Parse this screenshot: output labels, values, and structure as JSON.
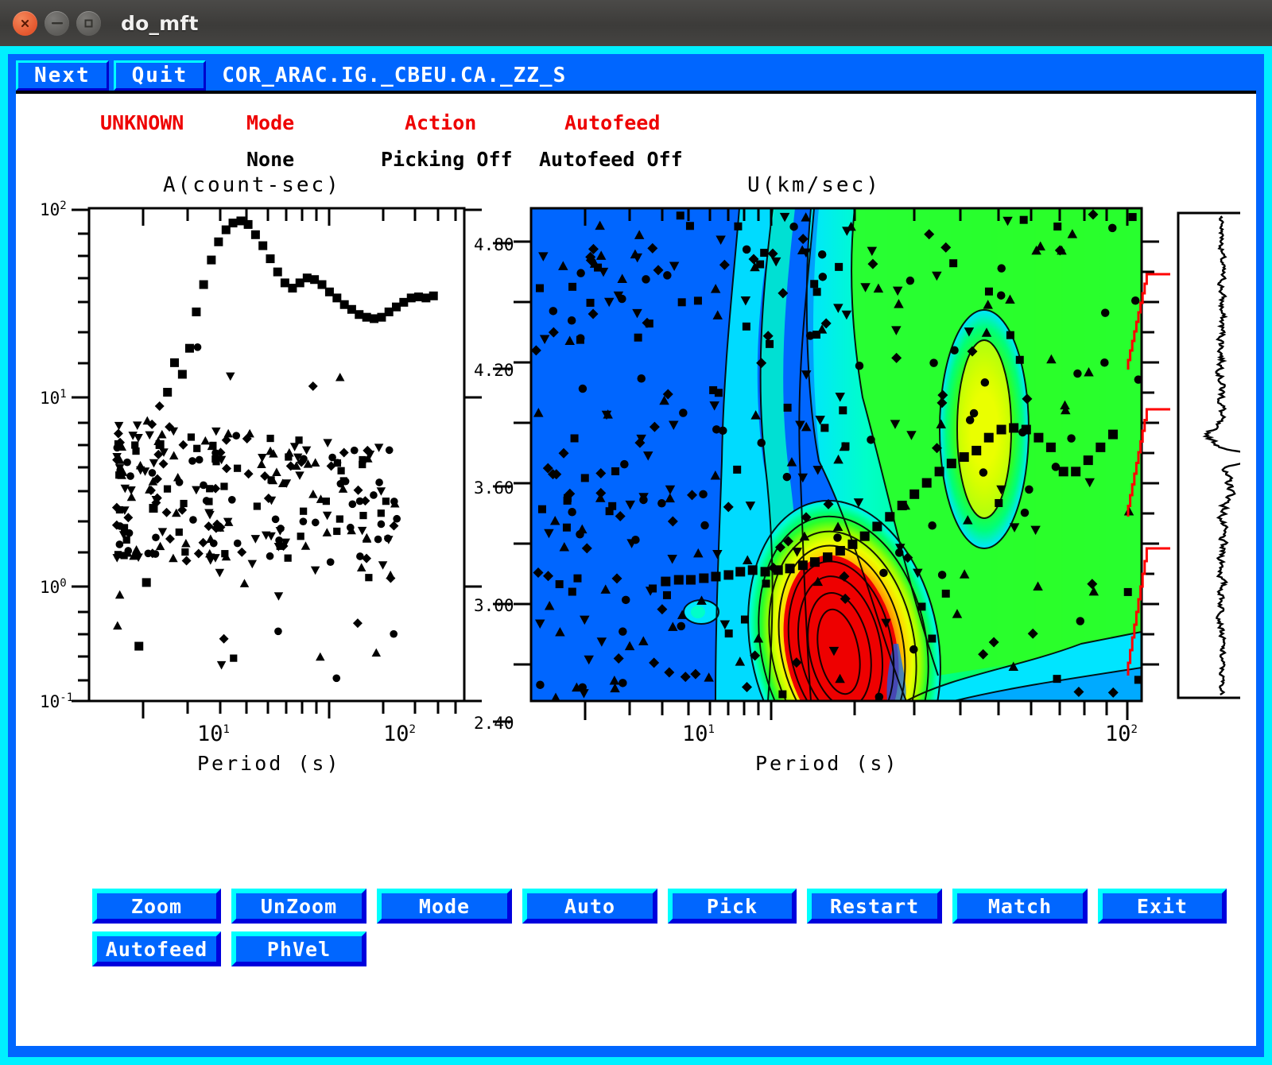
{
  "window": {
    "title": "do_mft",
    "buttons": {
      "close": "close-icon",
      "minimize": "minimize-icon",
      "maximize": "maximize-icon"
    },
    "frame_outer_color": "#00f0ff",
    "frame_inner_color": "#0066ff"
  },
  "menubar": {
    "next_label": "Next",
    "quit_label": "Quit",
    "trace_id": "COR_ARAC.IG._CBEU.CA._ZZ_S"
  },
  "status": {
    "headers": [
      {
        "label": "UNKNOWN",
        "color": "#ee0000"
      },
      {
        "label": "Mode",
        "color": "#ee0000"
      },
      {
        "label": "Action",
        "color": "#ee0000"
      },
      {
        "label": "Autofeed",
        "color": "#ee0000"
      }
    ],
    "values": [
      {
        "label": ""
      },
      {
        "label": "None"
      },
      {
        "label": "Picking Off"
      },
      {
        "label": "Autofeed Off"
      }
    ]
  },
  "chart_data": [
    {
      "id": "amplitude-plot",
      "type": "scatter",
      "title": "A(count-sec)",
      "xlabel": "Period (s)",
      "ylabel": "",
      "xscale": "log",
      "yscale": "log",
      "xlim": [
        3.0,
        140.0
      ],
      "ylim": [
        0.1,
        120.0
      ],
      "xticklabels": [
        "10^1",
        "10^2"
      ],
      "xtickvalues": [
        10,
        100
      ],
      "yticklabels": [
        "10^2",
        "10^1",
        "10^0",
        "10^-1"
      ],
      "ytickvalues": [
        100,
        10,
        1,
        0.1
      ],
      "grid": false,
      "series": [
        {
          "name": "fundamental-mode amplitude",
          "marker": "square",
          "x": [
            5.0,
            5.4,
            5.8,
            6.2,
            6.7,
            7.2,
            7.8,
            8.4,
            9.0,
            9.7,
            10.5,
            11.3,
            12.2,
            13.1,
            14.2,
            15.3,
            16.5,
            17.8,
            19.2,
            20.7,
            22.3,
            24.1,
            26.0,
            28.0,
            30.2,
            32.6,
            35.2,
            38.0,
            41.0,
            44.2,
            47.7,
            51.5,
            55.6,
            60.0,
            64.7,
            69.8,
            75.3,
            81.3,
            87.7,
            94.6,
            102.1
          ],
          "y": [
            0.22,
            0.55,
            1.6,
            4.0,
            8.5,
            13.0,
            11.0,
            16.0,
            27.0,
            40.0,
            57.0,
            74.0,
            88.0,
            97.0,
            100.0,
            95.0,
            82.0,
            70.0,
            58.0,
            48.0,
            41.0,
            38.0,
            41.0,
            44.0,
            43.0,
            40.0,
            36.0,
            33.0,
            30.0,
            28.0,
            26.0,
            25.0,
            24.5,
            25.0,
            27.0,
            29.0,
            31.0,
            33.0,
            33.5,
            33.0,
            34.0
          ]
        },
        {
          "name": "background spectral scatter",
          "marker": "mixed",
          "note": "dense cloud of square / triangle / diamond / circle markers between ~4 s and ~60 s period, amplitudes ~0.1 to ~15 count-sec, densest near 5-10 s at 1.5-5 count-sec",
          "count": 260
        }
      ]
    },
    {
      "id": "dispersion-contour-plot",
      "type": "heatmap",
      "title": "U(km/sec)",
      "xlabel": "Period (s)",
      "ylabel": "U (km/sec)",
      "xscale": "log",
      "xlim": [
        3.0,
        140.0
      ],
      "ylim": [
        2.05,
        5.1
      ],
      "xticklabels": [
        "10^1",
        "10^2"
      ],
      "xtickvalues": [
        10,
        100
      ],
      "yticklabels": [
        "4.80",
        "4.20",
        "3.60",
        "3.00",
        "2.40"
      ],
      "ytickvalues": [
        4.8,
        4.2,
        3.6,
        3.0,
        2.4
      ],
      "grid": false,
      "colormap": [
        "#0066ff",
        "#00aaff",
        "#00e5ff",
        "#00ffc8",
        "#00ff7a",
        "#2aff2a",
        "#9dff00",
        "#eaff00",
        "#ffd400",
        "#ff9000",
        "#ff4000",
        "#ee0000"
      ],
      "series": [
        {
          "name": "group velocity dispersion picks",
          "marker": "square",
          "x": [
            7.0,
            7.6,
            8.2,
            8.9,
            9.6,
            10.4,
            11.2,
            12.1,
            13.1,
            14.2,
            15.3,
            16.6,
            17.9,
            19.4,
            21.0,
            22.7,
            24.5,
            26.5,
            28.7,
            31.0,
            33.5,
            36.2,
            39.2,
            42.3,
            45.8,
            49.5,
            53.5,
            57.9,
            62.6,
            67.7,
            73.2,
            79.1,
            85.6,
            92.5,
            100.0,
            108.1,
            116.9
          ],
          "y": [
            2.79,
            2.8,
            2.8,
            2.81,
            2.82,
            2.83,
            2.85,
            2.86,
            2.85,
            2.86,
            2.87,
            2.89,
            2.91,
            2.94,
            2.98,
            3.02,
            3.07,
            3.13,
            3.19,
            3.26,
            3.33,
            3.4,
            3.47,
            3.52,
            3.56,
            3.6,
            3.68,
            3.73,
            3.74,
            3.73,
            3.68,
            3.62,
            3.47,
            3.47,
            3.54,
            3.62,
            3.7
          ]
        },
        {
          "name": "noise picks scatter",
          "marker": "mixed",
          "note": "hundreds of square / up-triangle / down-triangle / diamond / circle markers spread across the whole period-velocity plane",
          "count": 340
        }
      ],
      "energy_peak": {
        "period": 21.0,
        "velocity": 2.88,
        "note": "red maximum of the dispersion energy ridge"
      }
    },
    {
      "id": "waveform-trace",
      "type": "line",
      "title": "",
      "orientation": "vertical",
      "note": "filtered seismogram amplitude versus time, plotted vertically; one large positive excursion near the centre",
      "series": [
        {
          "name": "seismogram",
          "samples": 420
        }
      ]
    }
  ],
  "markers": {
    "red_selection_brackets": 3,
    "red_color": "#ff0000"
  },
  "buttons": {
    "row1": [
      {
        "label": "Zoom",
        "name": "zoom-button"
      },
      {
        "label": "UnZoom",
        "name": "unzoom-button"
      },
      {
        "label": "Mode",
        "name": "mode-button"
      },
      {
        "label": "Auto",
        "name": "auto-button"
      },
      {
        "label": "Pick",
        "name": "pick-button"
      },
      {
        "label": "Restart",
        "name": "restart-button"
      },
      {
        "label": "Match",
        "name": "match-button"
      },
      {
        "label": "Exit",
        "name": "exit-button"
      }
    ],
    "row2": [
      {
        "label": "Autofeed",
        "name": "autofeed-button"
      },
      {
        "label": "PhVel",
        "name": "phvel-button"
      }
    ]
  }
}
